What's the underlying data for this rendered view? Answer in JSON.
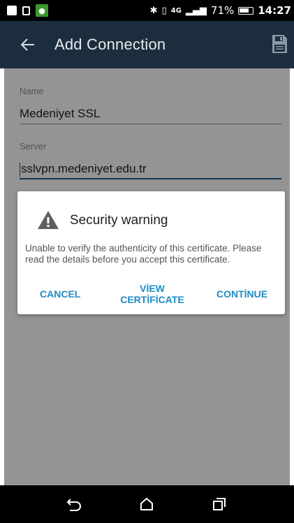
{
  "status_bar": {
    "battery_percent": "71%",
    "time": "14:27",
    "network": "4G",
    "icons": [
      "notification-square-icon",
      "clipboard-icon",
      "shield-app-icon",
      "bluetooth-icon",
      "vibrate-icon",
      "signal-icon",
      "battery-icon"
    ]
  },
  "app_bar": {
    "title": "Add Connection",
    "back_icon": "arrow-back-icon",
    "save_icon": "save-icon"
  },
  "form": {
    "name": {
      "label": "Name",
      "value": "Medeniyet SSL"
    },
    "server": {
      "label": "Server",
      "value": "sslvpn.medeniyet.edu.tr"
    }
  },
  "dialog": {
    "icon": "warning-icon",
    "title": "Security warning",
    "message": "Unable to verify the authenticity of this certificate. Please read the details before you accept this certificate.",
    "buttons": {
      "cancel": "CANCEL",
      "view_line1": "VİEW",
      "view_line2": "CERTİFİCATE",
      "continue": "CONTİNUE"
    },
    "accent_color": "#1e8bc3"
  },
  "nav_bar": {
    "icons": [
      "back-nav-icon",
      "home-nav-icon",
      "recents-nav-icon"
    ]
  },
  "colors": {
    "app_bar": "#1c2e3d",
    "field_active": "#1f5a83"
  }
}
